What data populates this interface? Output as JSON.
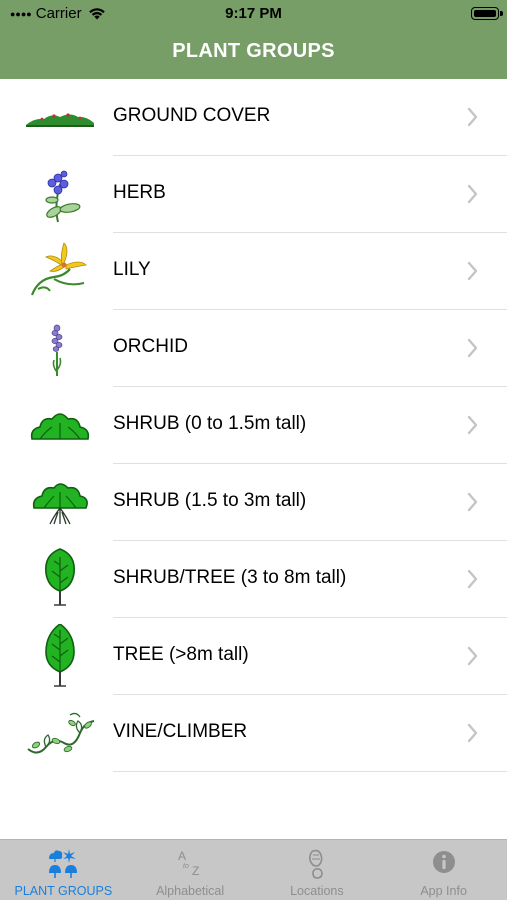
{
  "status_bar": {
    "carrier": "Carrier",
    "time": "9:17 PM"
  },
  "nav": {
    "title": "PLANT GROUPS",
    "background_color": "#789e68"
  },
  "plant_groups": [
    {
      "label": "GROUND COVER",
      "icon": "ground-cover-icon"
    },
    {
      "label": "HERB",
      "icon": "herb-icon"
    },
    {
      "label": "LILY",
      "icon": "lily-icon"
    },
    {
      "label": "ORCHID",
      "icon": "orchid-icon"
    },
    {
      "label": "SHRUB (0 to 1.5m tall)",
      "icon": "low-shrub-icon"
    },
    {
      "label": "SHRUB (1.5 to 3m tall)",
      "icon": "tall-shrub-icon"
    },
    {
      "label": "SHRUB/TREE (3 to 8m tall)",
      "icon": "shrub-tree-icon"
    },
    {
      "label": "TREE (>8m tall)",
      "icon": "tree-icon"
    },
    {
      "label": "VINE/CLIMBER",
      "icon": "vine-icon"
    }
  ],
  "tabbar": {
    "active_color": "#1a7fdc",
    "tabs": [
      {
        "label": "PLANT GROUPS",
        "icon": "plant-groups-tab-icon",
        "active": true
      },
      {
        "label": "Alphabetical",
        "icon": "alphabetical-tab-icon",
        "active": false
      },
      {
        "label": "Locations",
        "icon": "footprint-tab-icon",
        "active": false
      },
      {
        "label": "App Info",
        "icon": "info-tab-icon",
        "active": false
      }
    ]
  }
}
